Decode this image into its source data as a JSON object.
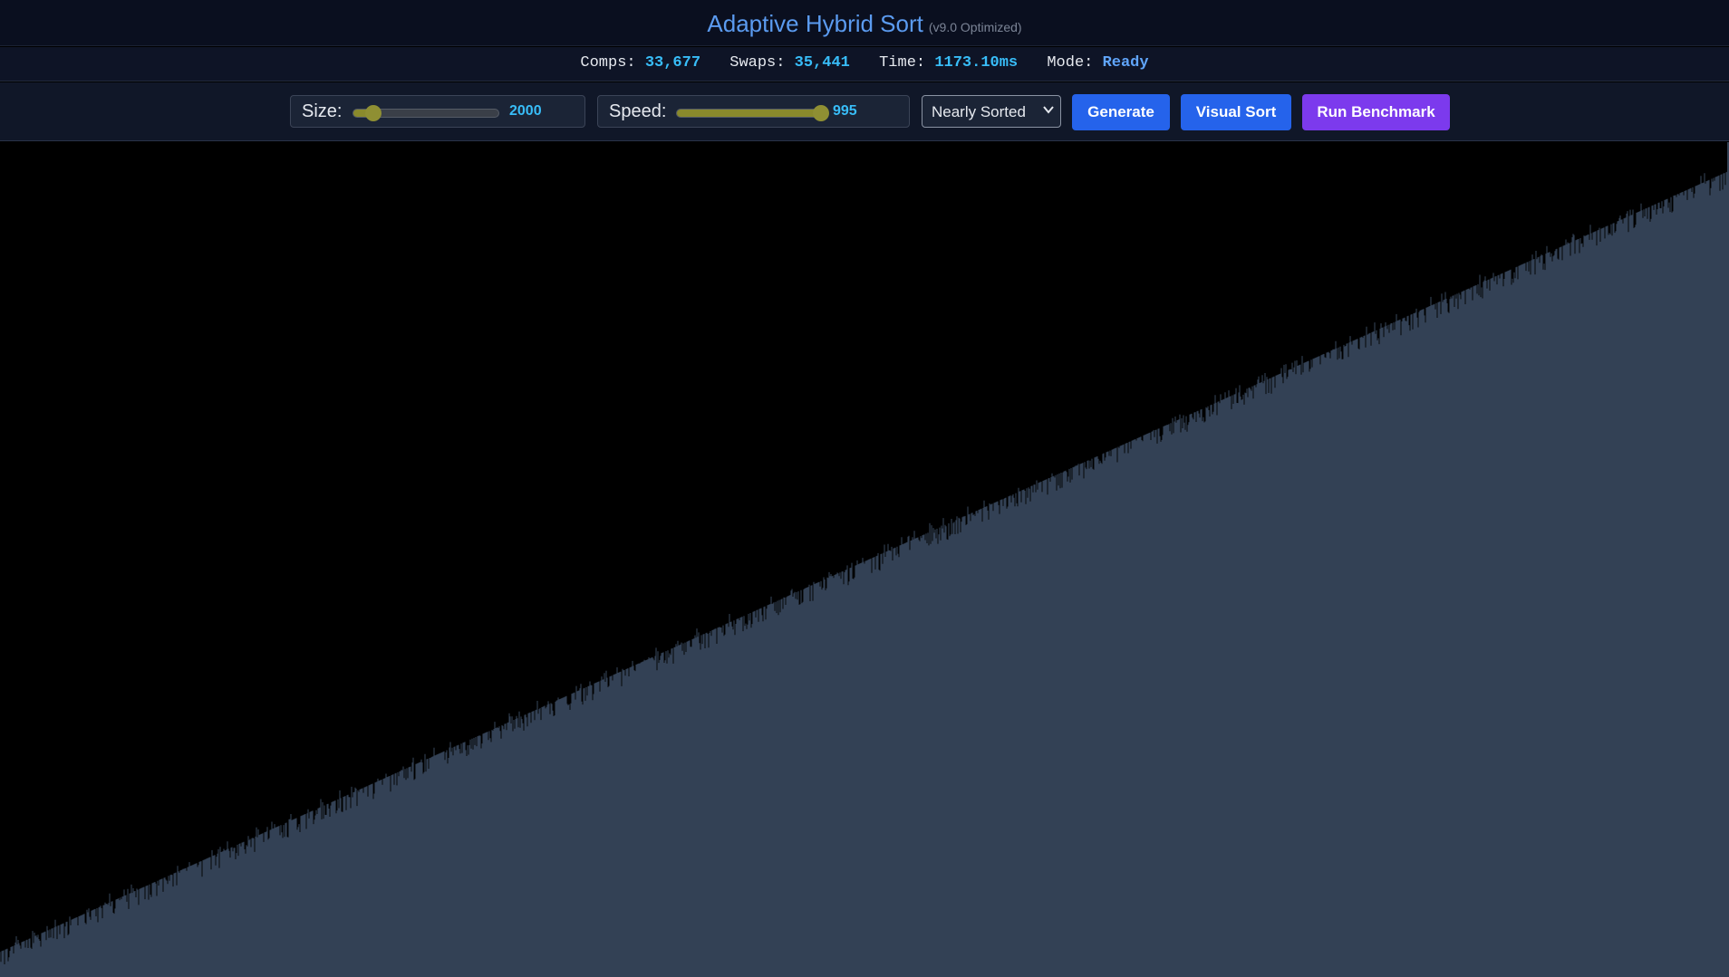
{
  "header": {
    "title": "Adaptive Hybrid Sort",
    "version": "(v9.0 Optimized)"
  },
  "stats": {
    "comps_label": "Comps:",
    "comps_value": "33,677",
    "swaps_label": "Swaps:",
    "swaps_value": "35,441",
    "time_label": "Time:",
    "time_value": "1173.10ms",
    "mode_label": "Mode:",
    "mode_value": "Ready"
  },
  "controls": {
    "size": {
      "label": "Size:",
      "value": "2000",
      "fraction": 0.14
    },
    "speed": {
      "label": "Speed:",
      "value": "995",
      "fraction": 0.995
    },
    "distribution": {
      "selected": "Nearly Sorted"
    },
    "buttons": {
      "generate": "Generate",
      "visual_sort": "Visual Sort",
      "run_benchmark": "Run Benchmark"
    }
  },
  "visualization": {
    "type": "bar",
    "bar_count": 2000,
    "order": "nearly sorted ascending",
    "colors": {
      "bar": "#334155",
      "background": "#000000"
    }
  },
  "colors": {
    "accent_value": "#38bdf8",
    "title": "#5b9bf0",
    "button_blue": "#2563eb",
    "button_purple": "#7c3aed",
    "slider_fill": "#8a8a2c"
  }
}
